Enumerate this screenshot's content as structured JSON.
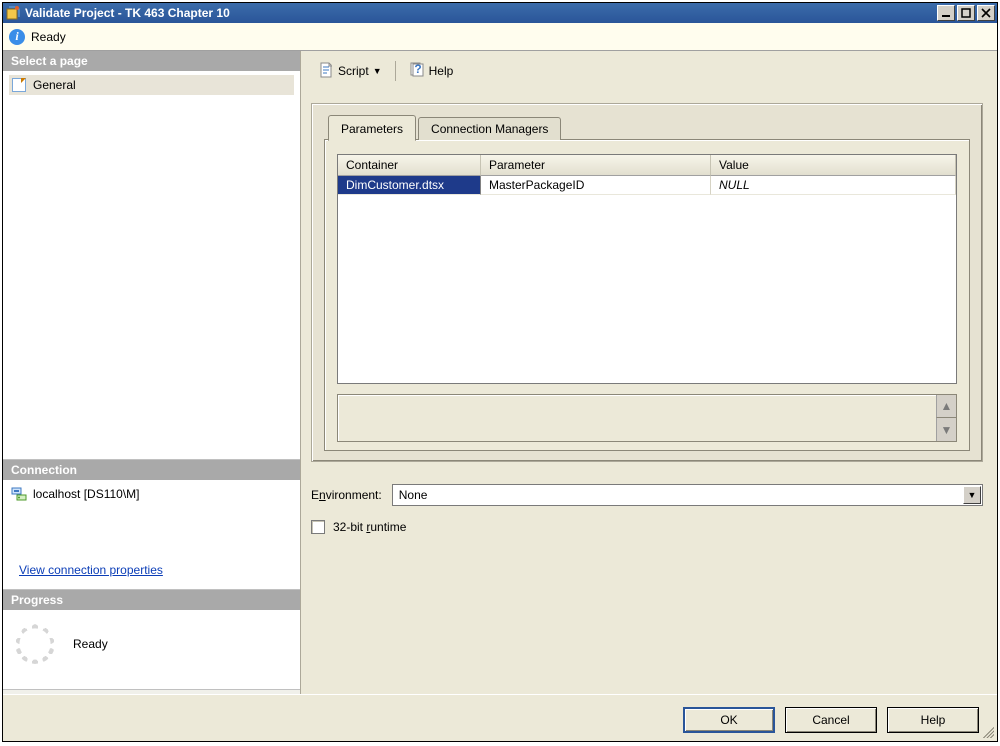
{
  "window": {
    "title": "Validate Project - TK 463 Chapter 10"
  },
  "ready_bar": {
    "status": "Ready"
  },
  "sidebar": {
    "select_page_header": "Select a page",
    "pages": [
      {
        "label": "General"
      }
    ],
    "connection_header": "Connection",
    "connection_item": "localhost [DS110\\M]",
    "view_conn_link": "View connection properties",
    "progress_header": "Progress",
    "progress_status": "Ready"
  },
  "toolbar": {
    "script_label": "Script",
    "help_label": "Help"
  },
  "tabs": {
    "parameters": "Parameters",
    "connection_managers": "Connection Managers"
  },
  "grid": {
    "headers": {
      "container": "Container",
      "parameter": "Parameter",
      "value": "Value"
    },
    "rows": [
      {
        "container": "DimCustomer.dtsx",
        "parameter": "MasterPackageID",
        "value": "NULL"
      }
    ]
  },
  "environment": {
    "label_pre": "E",
    "label_u": "n",
    "label_post": "vironment:",
    "selected": "None"
  },
  "checkbox": {
    "label_pre": "32-bit ",
    "label_u": "r",
    "label_post": "untime"
  },
  "buttons": {
    "ok": "OK",
    "cancel": "Cancel",
    "help": "Help"
  }
}
